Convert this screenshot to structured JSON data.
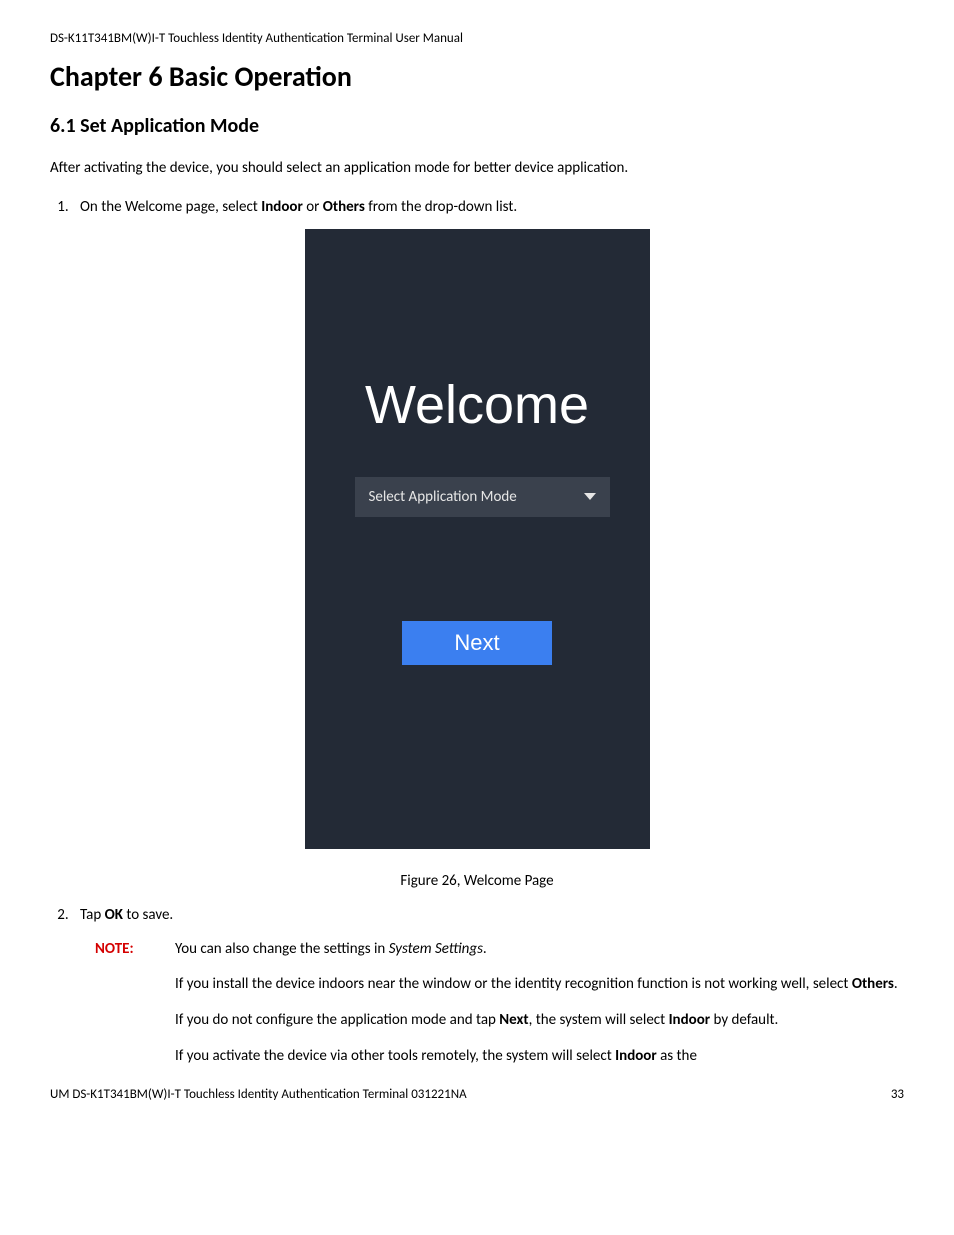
{
  "header": "DS-K11T341BM(W)I-T Touchless Identity Authentication Terminal User Manual",
  "chapter_title": "Chapter 6 Basic Operation",
  "section_title": "6.1 Set Application Mode",
  "intro": "After activating the device, you should select an application mode for better device application.",
  "step1_a": "On the Welcome page, select ",
  "step1_b": "Indoor",
  "step1_c": " or ",
  "step1_d": "Others",
  "step1_e": " from the drop-down list.",
  "device": {
    "welcome": "Welcome",
    "dropdown_label": "Select Application Mode",
    "next_label": "Next"
  },
  "figure_caption": "Figure 26, Welcome Page",
  "step2_a": "Tap ",
  "step2_b": "OK",
  "step2_c": " to save.",
  "note_label": "NOTE:",
  "note1_a": "You can also change the settings in ",
  "note1_b": "System Settings",
  "note1_c": ".",
  "note2_a": "If you install the device indoors near the window or the identity recognition function is not working well, select ",
  "note2_b": "Others",
  "note2_c": ".",
  "note3_a": "If you do not configure the application mode and tap ",
  "note3_b": "Next",
  "note3_c": ", the system will select ",
  "note3_d": "Indoor",
  "note3_e": " by default.",
  "note4_a": "If you activate the device via other tools remotely, the system will select ",
  "note4_b": "Indoor",
  "note4_c": " as the",
  "footer_left": "UM DS-K1T341BM(W)I-T Touchless Identity Authentication Terminal 031221NA",
  "footer_right": "33"
}
